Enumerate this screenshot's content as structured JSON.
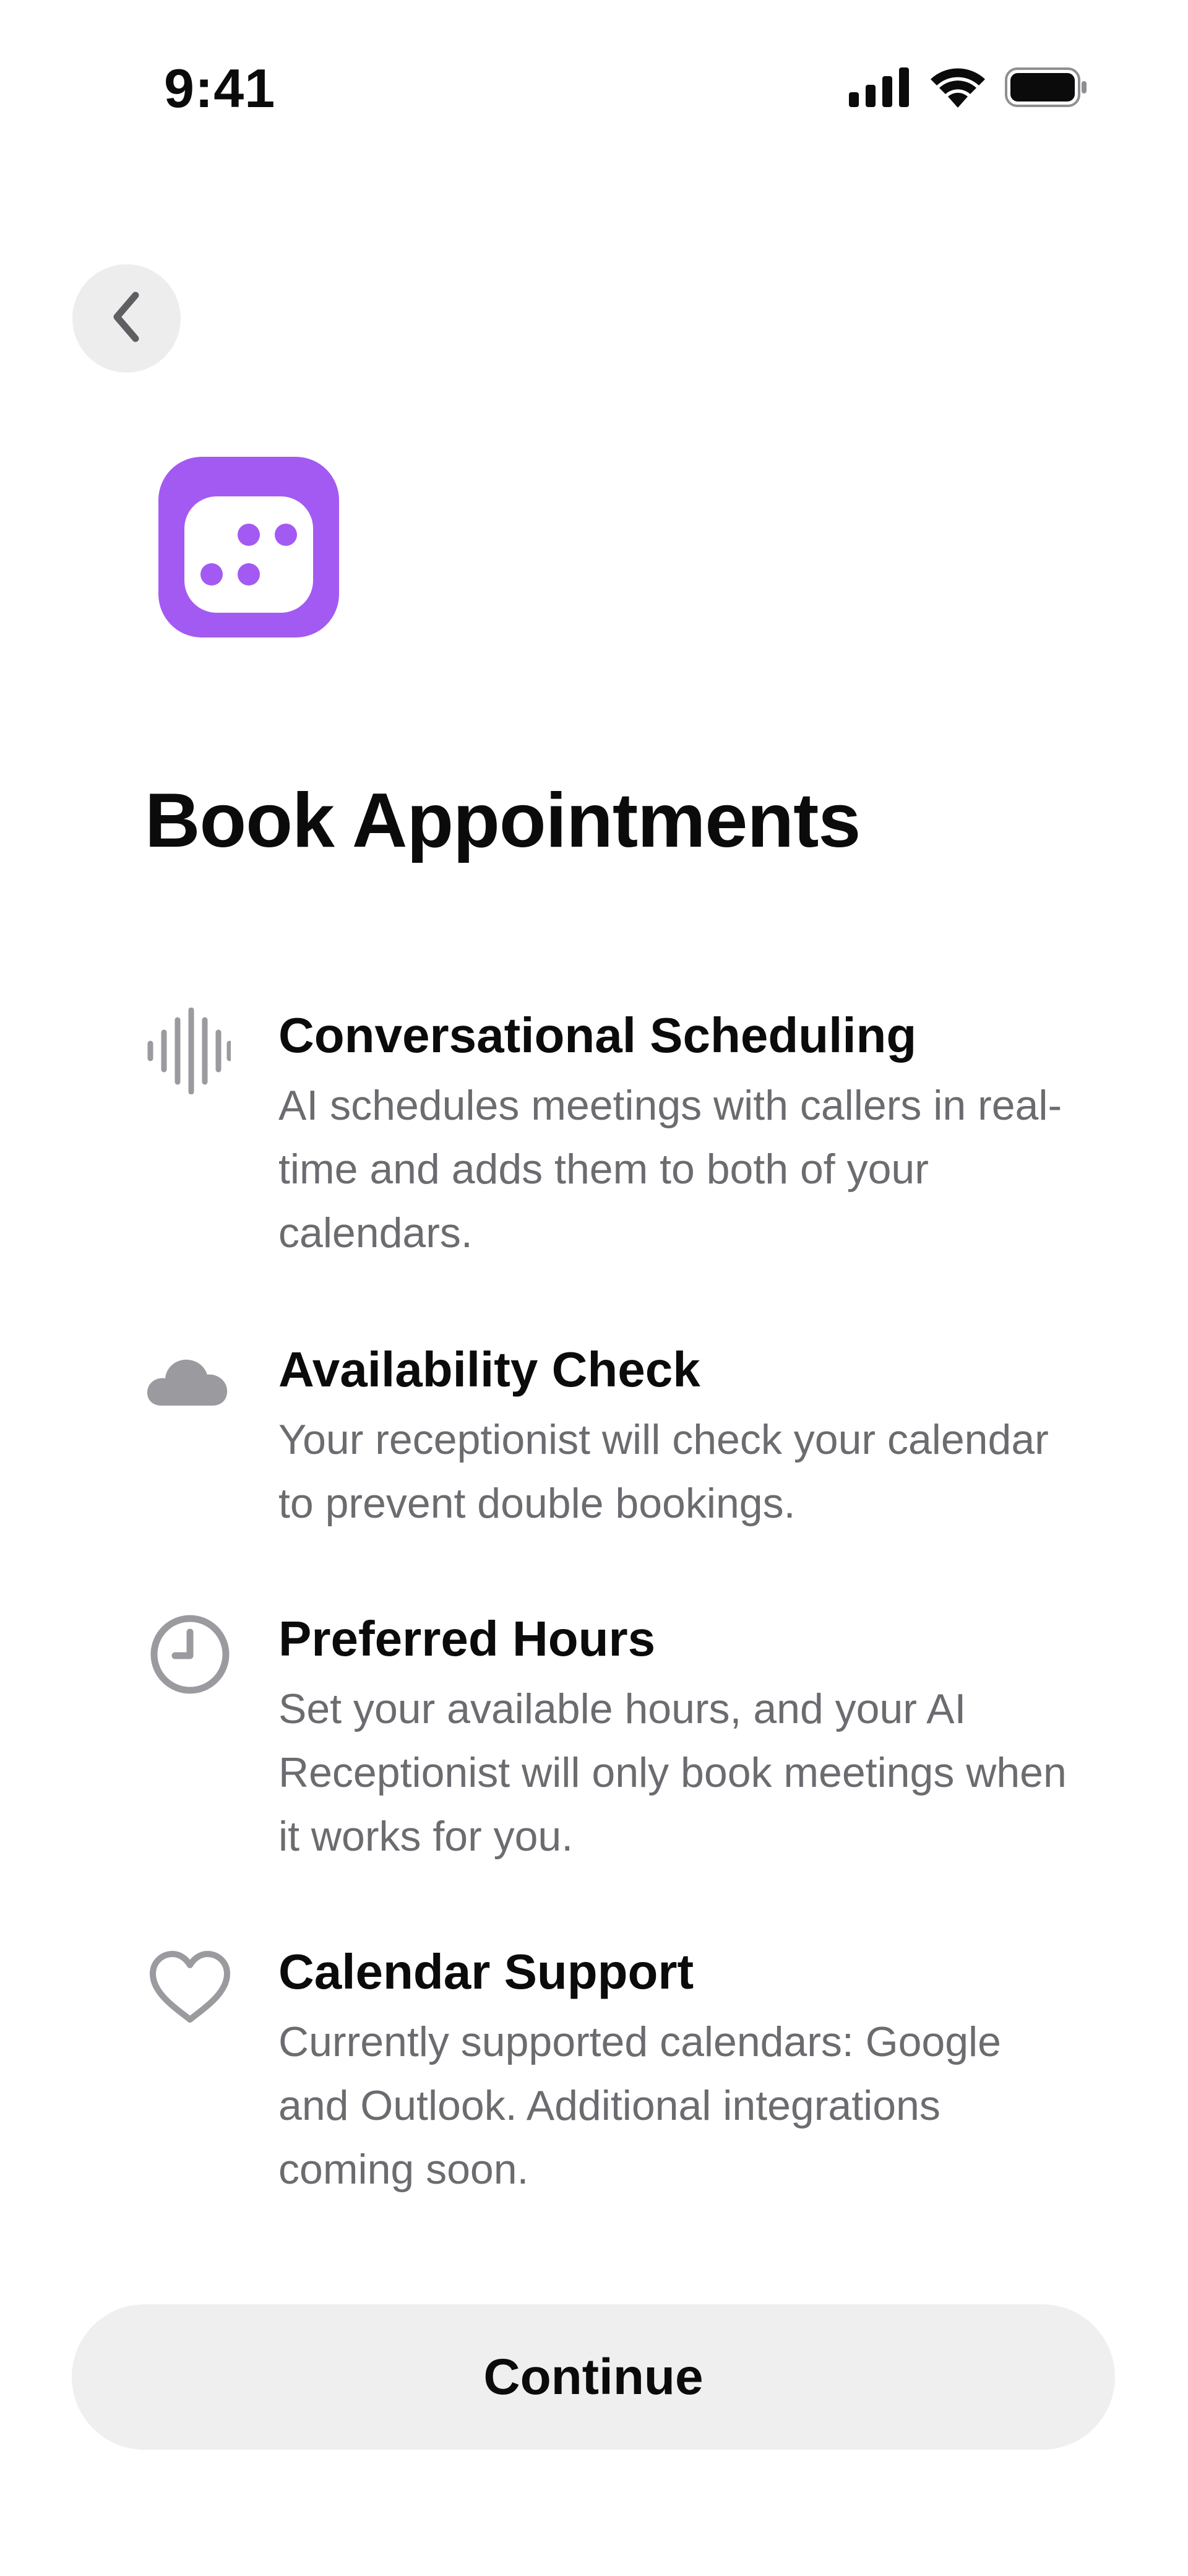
{
  "status_bar": {
    "time": "9:41",
    "icons": [
      "cellular-signal-icon",
      "wifi-icon",
      "battery-icon"
    ]
  },
  "navigation": {
    "back_icon": "chevron-left-icon"
  },
  "app_icon": {
    "name": "dice-calendar-icon",
    "color": "#a35af2"
  },
  "title": "Book Appointments",
  "features": [
    {
      "icon": "waveform-icon",
      "title": "Conversational Scheduling",
      "description": "AI schedules meetings with callers in real-time and adds them to both of your calendars."
    },
    {
      "icon": "cloud-icon",
      "title": "Availability Check",
      "description": "Your receptionist will check your calendar to prevent double bookings."
    },
    {
      "icon": "clock-icon",
      "title": "Preferred Hours",
      "description": "Set your available hours, and your AI Receptionist will only book meetings when it works for you."
    },
    {
      "icon": "heart-icon",
      "title": "Calendar Support",
      "description": "Currently supported calendars: Google and Outlook. Additional integrations coming soon."
    }
  ],
  "continue_label": "Continue",
  "colors": {
    "accent": "#a35af2",
    "icon_gray": "#9a9a9f",
    "secondary_text": "#6b6b70",
    "button_bg": "#efefef"
  }
}
